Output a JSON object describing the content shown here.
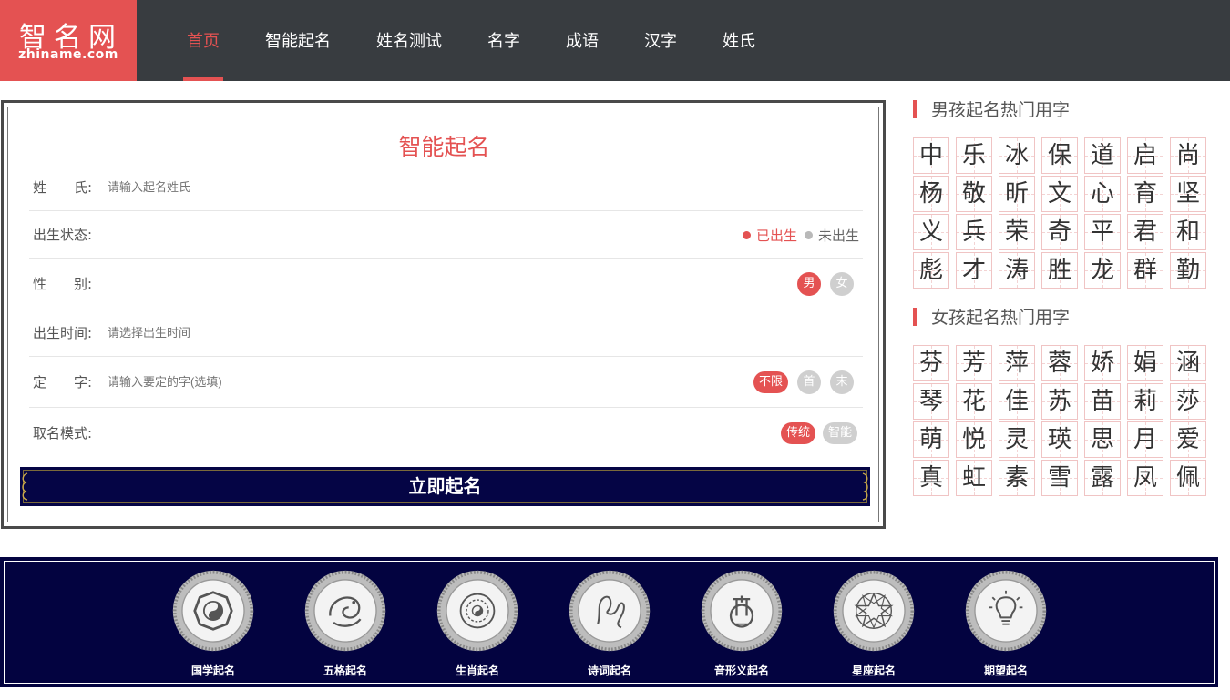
{
  "logo": {
    "cn": "智名网",
    "en": "zhiname.com"
  },
  "nav": [
    {
      "label": "首页",
      "active": true
    },
    {
      "label": "智能起名"
    },
    {
      "label": "姓名测试"
    },
    {
      "label": "名字"
    },
    {
      "label": "成语"
    },
    {
      "label": "汉字"
    },
    {
      "label": "姓氏"
    }
  ],
  "form": {
    "title": "智能起名",
    "surname": {
      "label": "姓　　氏:",
      "placeholder": "请输入起名姓氏"
    },
    "birth_status": {
      "label": "出生状态:",
      "options": [
        "已出生",
        "未出生"
      ],
      "selected": "已出生"
    },
    "gender": {
      "label": "性　　别:",
      "options": [
        "男",
        "女"
      ],
      "selected": "男"
    },
    "birth_time": {
      "label": "出生时间:",
      "placeholder": "请选择出生时间"
    },
    "fixed_char": {
      "label": "定　　字:",
      "placeholder": "请输入要定的字(选填)",
      "options": [
        "不限",
        "首",
        "末"
      ],
      "selected": "不限"
    },
    "mode": {
      "label": "取名模式:",
      "options": [
        "传统",
        "智能"
      ],
      "selected": "传统"
    },
    "submit_label": "立即起名"
  },
  "boy_chars": {
    "title": "男孩起名热门用字",
    "chars": [
      "中",
      "乐",
      "冰",
      "保",
      "道",
      "启",
      "尚",
      "杨",
      "敬",
      "昕",
      "文",
      "心",
      "育",
      "坚",
      "义",
      "兵",
      "荣",
      "奇",
      "平",
      "君",
      "和",
      "彪",
      "才",
      "涛",
      "胜",
      "龙",
      "群",
      "勤"
    ]
  },
  "girl_chars": {
    "title": "女孩起名热门用字",
    "chars": [
      "芬",
      "芳",
      "萍",
      "蓉",
      "娇",
      "娟",
      "涵",
      "琴",
      "花",
      "佳",
      "苏",
      "苗",
      "莉",
      "莎",
      "萌",
      "悦",
      "灵",
      "瑛",
      "思",
      "月",
      "爱",
      "真",
      "虹",
      "素",
      "雪",
      "露",
      "凤",
      "佩"
    ]
  },
  "services": [
    {
      "label": "国学起名",
      "icon": "bagua-icon"
    },
    {
      "label": "五格起名",
      "icon": "dragon-icon"
    },
    {
      "label": "生肖起名",
      "icon": "zodiac-wheel-icon"
    },
    {
      "label": "诗词起名",
      "icon": "calligraphy-icon"
    },
    {
      "label": "音形义起名",
      "icon": "lyre-icon"
    },
    {
      "label": "星座起名",
      "icon": "star-mandala-icon"
    },
    {
      "label": "期望起名",
      "icon": "lightbulb-icon"
    }
  ],
  "colors": {
    "accent": "#e45252",
    "header_bg": "#383c40",
    "navy": "#030340"
  }
}
